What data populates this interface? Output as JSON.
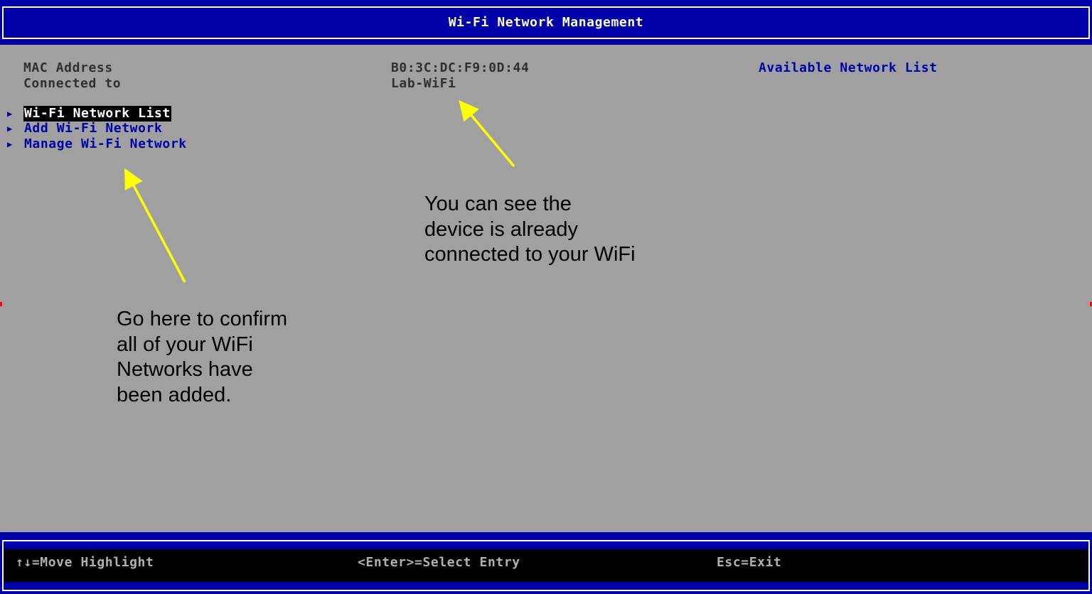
{
  "header": {
    "title": "Wi-Fi Network Management"
  },
  "info": {
    "mac_label": "MAC Address",
    "mac_value": "B0:3C:DC:F9:0D:44",
    "connected_label": "Connected to",
    "connected_value": "Lab-WiFi"
  },
  "help": {
    "title": "Available Network List"
  },
  "menu": {
    "items": [
      {
        "label": "Wi-Fi Network List",
        "selected": true
      },
      {
        "label": "Add Wi-Fi Network",
        "selected": false
      },
      {
        "label": "Manage Wi-Fi Network",
        "selected": false
      }
    ],
    "arrow_glyph": "▶"
  },
  "annotations": {
    "connected_note": [
      "You can see the",
      "device is already",
      "connected to your WiFi"
    ],
    "list_note": [
      "Go here to confirm",
      "all of your WiFi",
      "Networks have",
      "been added."
    ]
  },
  "footer": {
    "move": "↑↓=Move Highlight",
    "select": "<Enter>=Select Entry",
    "exit": "Esc=Exit"
  },
  "colors": {
    "bios_blue": "#0000a8",
    "background_gray": "#a0a0a0",
    "arrow_yellow": "#ffff00"
  }
}
